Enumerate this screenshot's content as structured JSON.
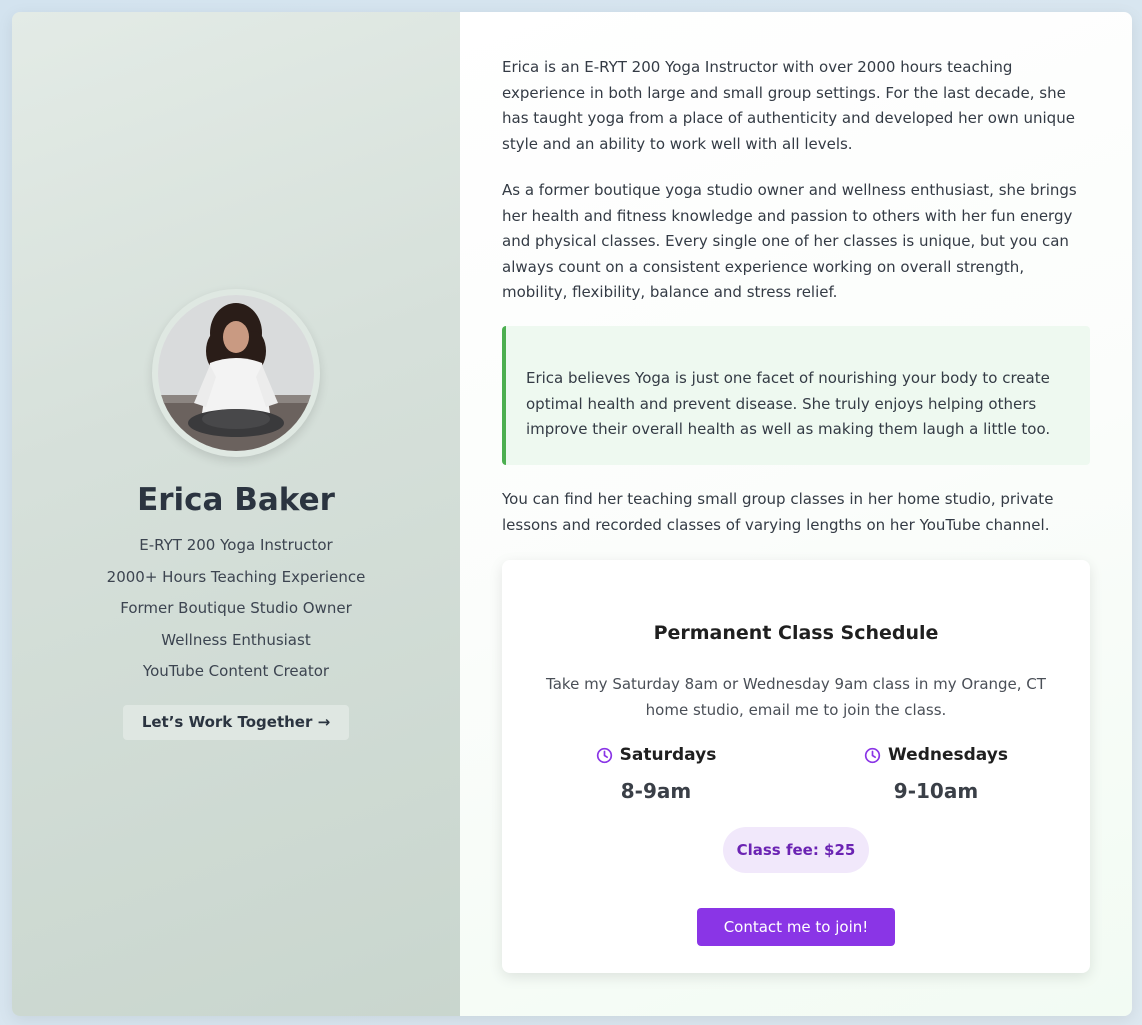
{
  "profile": {
    "name": "Erica Baker",
    "credentials": [
      "E-RYT 200 Yoga Instructor",
      "2000+ Hours Teaching Experience",
      "Former Boutique Studio Owner",
      "Wellness Enthusiast",
      "YouTube Content Creator"
    ],
    "cta_label": "Let’s Work Together →"
  },
  "bio": {
    "paragraph_1": "Erica is an E-RYT 200 Yoga Instructor with over 2000 hours teaching experience in both large and small group settings. For the last decade, she has taught yoga from a place of authenticity and developed her own unique style and an ability to work well with all levels.",
    "paragraph_2": "As a former boutique yoga studio owner and wellness enthusiast, she brings her health and fitness knowledge and passion to others with her fun energy and physical classes. Every single one of her classes is unique, but you can always count on a consistent experience working on overall strength, mobility, flexibility, balance and stress relief.",
    "quote": "Erica believes Yoga is just one facet of nourishing your body to create optimal health and prevent disease. She truly enjoys helping others improve their overall health as well as making them laugh a little too.",
    "paragraph_3": "You can find her teaching small group classes in her home studio, private lessons and recorded classes of varying lengths on her YouTube channel."
  },
  "schedule": {
    "title": "Permanent Class Schedule",
    "description": "Take my Saturday 8am or Wednesday 9am class in my Orange, CT home studio, email me to join the class.",
    "days": [
      {
        "name": "Saturdays",
        "time": "8-9am",
        "icon": "clock-icon"
      },
      {
        "name": "Wednesdays",
        "time": "9-10am",
        "icon": "clock-icon"
      }
    ],
    "fee": "Class fee: $25",
    "contact_label": "Contact me to join!"
  },
  "colors": {
    "accent_purple": "#8a35e6",
    "quote_border_green": "#4caf50",
    "fee_badge_bg": "#f1e8fb"
  }
}
